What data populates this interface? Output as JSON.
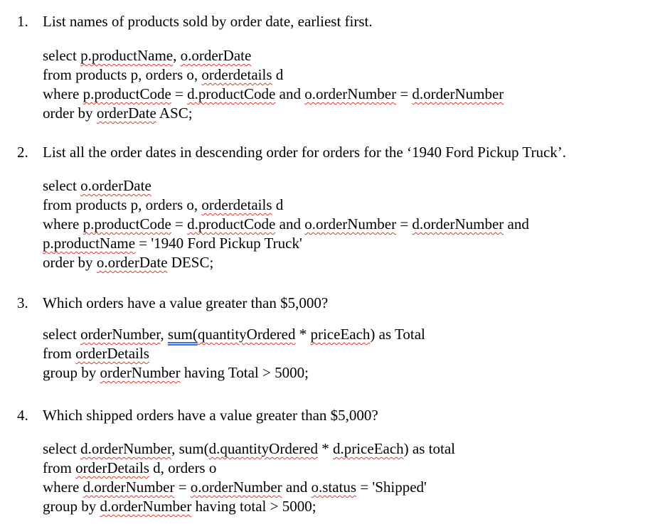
{
  "questions": [
    {
      "number": "1.",
      "text": "List names of products sold by order date, earliest first.",
      "lines": [
        [
          {
            "t": "select "
          },
          {
            "t": "p.productName",
            "sq": true
          },
          {
            "t": ", "
          },
          {
            "t": "o.orderDate",
            "sq": true
          }
        ],
        [
          {
            "t": "from products p, orders o, "
          },
          {
            "t": "orderdetails",
            "sq": true
          },
          {
            "t": " d"
          }
        ],
        [
          {
            "t": "where "
          },
          {
            "t": "p.productCode",
            "sq": true
          },
          {
            "t": " = "
          },
          {
            "t": "d.productCode",
            "sq": true
          },
          {
            "t": " and "
          },
          {
            "t": "o.orderNumber",
            "sq": true
          },
          {
            "t": " = "
          },
          {
            "t": "d.orderNumber",
            "sq": true
          }
        ],
        [
          {
            "t": "order by "
          },
          {
            "t": "orderDate",
            "sq": true
          },
          {
            "t": " ASC;"
          }
        ]
      ]
    },
    {
      "number": "2.",
      "text": "List all the order dates in descending order for orders for the ‘1940 Ford Pickup Truck’.",
      "lines": [
        [
          {
            "t": "select "
          },
          {
            "t": "o.orderDate",
            "sq": true
          }
        ],
        [
          {
            "t": "from products p, orders o, "
          },
          {
            "t": "orderdetails",
            "sq": true
          },
          {
            "t": " d"
          }
        ],
        [
          {
            "t": "where "
          },
          {
            "t": "p.productCode",
            "sq": true
          },
          {
            "t": " = "
          },
          {
            "t": "d.productCode",
            "sq": true
          },
          {
            "t": " and "
          },
          {
            "t": "o.orderNumber",
            "sq": true
          },
          {
            "t": " = "
          },
          {
            "t": "d.orderNumber",
            "sq": true
          },
          {
            "t": " and"
          }
        ],
        [
          {
            "t": "p.productName",
            "sq": true
          },
          {
            "t": " = '1940 Ford Pickup Truck'"
          }
        ],
        [
          {
            "t": "order by "
          },
          {
            "t": "o.orderDate",
            "sq": true
          },
          {
            "t": " DESC;"
          }
        ]
      ]
    },
    {
      "number": "3.",
      "text": "Which orders have a value greater than $5,000?",
      "lines": [
        [
          {
            "t": "select "
          },
          {
            "t": "orderNumber",
            "sq": true
          },
          {
            "t": ", "
          },
          {
            "t": "sum(",
            "bq": true
          },
          {
            "t": "quantityOrdered",
            "sq": true
          },
          {
            "t": " * "
          },
          {
            "t": "priceEach",
            "sq": true
          },
          {
            "t": ") as Total"
          }
        ],
        [
          {
            "t": "from "
          },
          {
            "t": "orderDetails",
            "sq": true
          }
        ],
        [
          {
            "t": "group by "
          },
          {
            "t": "orderNumber",
            "sq": true
          },
          {
            "t": " having Total > 5000;"
          }
        ]
      ]
    },
    {
      "number": "4.",
      "text": "Which shipped orders have a value greater than $5,000?",
      "lines": [
        [
          {
            "t": "select "
          },
          {
            "t": "d.orderNumber",
            "sq": true
          },
          {
            "t": ", sum("
          },
          {
            "t": "d.quantityOrdered",
            "sq": true
          },
          {
            "t": " * "
          },
          {
            "t": "d.priceEach",
            "sq": true
          },
          {
            "t": ") as total"
          }
        ],
        [
          {
            "t": "from "
          },
          {
            "t": "orderDetails",
            "sq": true
          },
          {
            "t": " d, orders o"
          }
        ],
        [
          {
            "t": "where "
          },
          {
            "t": "d.orderNumber",
            "sq": true
          },
          {
            "t": " = "
          },
          {
            "t": "o.orderNumber",
            "sq": true
          },
          {
            "t": " and "
          },
          {
            "t": "o.status",
            "sq": true
          },
          {
            "t": " = 'Shipped'"
          }
        ],
        [
          {
            "t": "group by "
          },
          {
            "t": "d.orderNumber",
            "sq": true
          },
          {
            "t": " having total > 5000;"
          }
        ]
      ]
    }
  ]
}
